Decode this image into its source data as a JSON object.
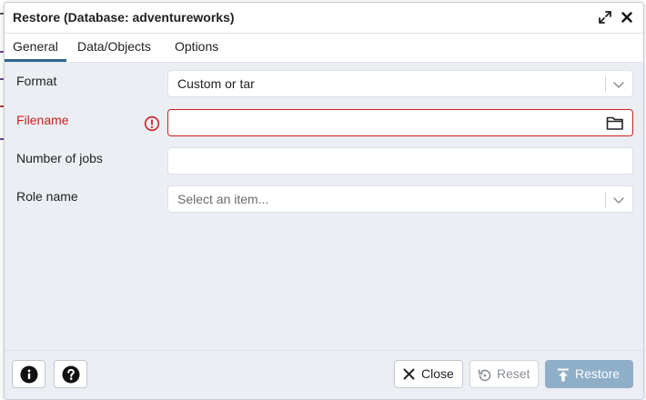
{
  "dialog": {
    "title": "Restore (Database: adventureworks)"
  },
  "tabs": [
    {
      "label": "General",
      "active": true
    },
    {
      "label": "Data/Objects",
      "active": false
    },
    {
      "label": "Options",
      "active": false
    }
  ],
  "form": {
    "format": {
      "label": "Format",
      "value": "Custom or tar"
    },
    "filename": {
      "label": "Filename",
      "value": "",
      "has_error": true
    },
    "jobs": {
      "label": "Number of jobs",
      "value": ""
    },
    "role": {
      "label": "Role name",
      "placeholder": "Select an item..."
    }
  },
  "footer": {
    "close_label": "Close",
    "reset_label": "Reset",
    "restore_label": "Restore"
  },
  "icons": {
    "expand": "expand-icon",
    "close": "close-icon",
    "error": "error-circle-icon",
    "folder": "folder-icon",
    "info": "info-icon",
    "help": "help-icon",
    "reset": "reset-icon",
    "upload": "upload-icon"
  },
  "colors": {
    "accent": "#326690",
    "error": "#ce1f1f",
    "primary_disabled": "#8faec8",
    "dialog_bg": "#ebeef3"
  }
}
